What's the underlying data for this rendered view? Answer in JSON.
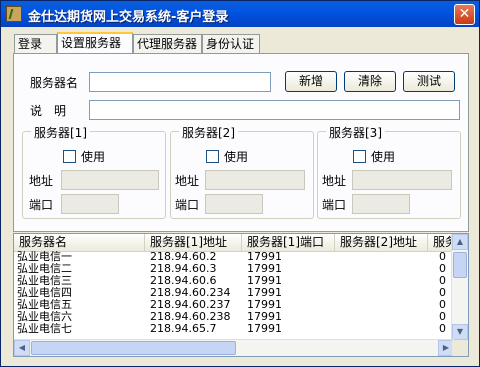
{
  "window": {
    "title": "金仕达期货网上交易系统-客户登录",
    "close_glyph": "✕"
  },
  "tabs": [
    {
      "label": "登录"
    },
    {
      "label": "设置服务器"
    },
    {
      "label": "代理服务器"
    },
    {
      "label": "身份认证"
    }
  ],
  "form": {
    "server_name_label": "服务器名",
    "description_label": "说　明",
    "server_name_value": "",
    "description_value": "",
    "add_button": "新增",
    "clear_button": "清除",
    "test_button": "测试"
  },
  "groups": [
    {
      "title": "服务器[1]",
      "use_label": "使用",
      "address_label": "地址",
      "port_label": "端口"
    },
    {
      "title": "服务器[2]",
      "use_label": "使用",
      "address_label": "地址",
      "port_label": "端口"
    },
    {
      "title": "服务器[3]",
      "use_label": "使用",
      "address_label": "地址",
      "port_label": "端口"
    }
  ],
  "list": {
    "columns": [
      "服务器名",
      "服务器[1]地址",
      "服务器[1]端口",
      "服务器[2]地址",
      "服务"
    ],
    "rows": [
      [
        "弘业电信一",
        "218.94.60.2",
        "17991",
        "",
        "0"
      ],
      [
        "弘业电信二",
        "218.94.60.3",
        "17991",
        "",
        "0"
      ],
      [
        "弘业电信三",
        "218.94.60.6",
        "17991",
        "",
        "0"
      ],
      [
        "弘业电信四",
        "218.94.60.234",
        "17991",
        "",
        "0"
      ],
      [
        "弘业电信五",
        "218.94.60.237",
        "17991",
        "",
        "0"
      ],
      [
        "弘业电信六",
        "218.94.60.238",
        "17991",
        "",
        "0"
      ],
      [
        "弘业电信七",
        "218.94.65.7",
        "17991",
        "",
        "0"
      ]
    ]
  },
  "icons": {
    "scroll_up": "▲",
    "scroll_down": "▼",
    "scroll_left": "◀",
    "scroll_right": "▶"
  }
}
